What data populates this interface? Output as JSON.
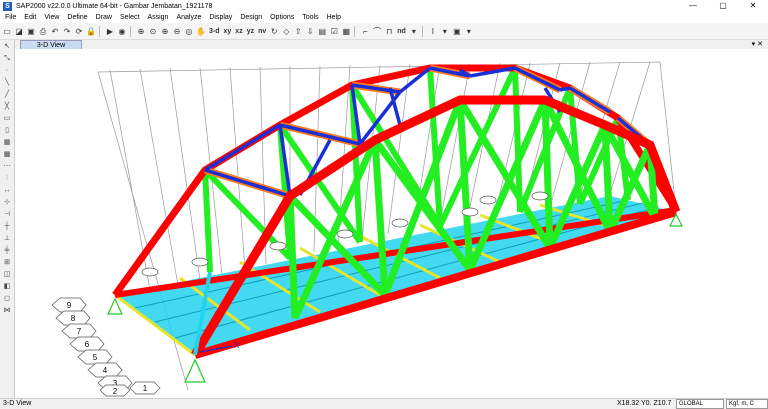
{
  "window": {
    "title": "SAP2000 v22.0.0 Ultimate 64-bit - Gambar Jembatan_1921178",
    "logo_letter": "S",
    "min_glyph": "—",
    "max_glyph": "▢",
    "close_glyph": "✕"
  },
  "menu": {
    "items": [
      "File",
      "Edit",
      "View",
      "Define",
      "Draw",
      "Select",
      "Assign",
      "Analyze",
      "Display",
      "Design",
      "Options",
      "Tools",
      "Help"
    ]
  },
  "toolbar": {
    "view_3d_label": "3-d",
    "view_xy_label": "xy",
    "view_xz_label": "xz",
    "view_yz_label": "yz",
    "view_nv_label": "nv",
    "view_nd_label": "nd"
  },
  "tab": {
    "label": "3-D View"
  },
  "statusbar": {
    "left_text": "3-D View",
    "coords": "X18.32  Y0.  Z10.7",
    "coord_system": "GLOBAL",
    "units": "Kgf, m, C"
  },
  "model": {
    "axis_label": "X",
    "tags_front": [
      "9",
      "8",
      "7",
      "6",
      "5",
      "4",
      "3",
      "2",
      "1"
    ],
    "colors": {
      "top_chord": "#ff0000",
      "diagonals": "#22ee22",
      "bracing_top": "#1b2fd6",
      "portal_beam": "#ff7a1a",
      "deck": "#22d3ee",
      "stringer": "#e5e52a"
    }
  }
}
